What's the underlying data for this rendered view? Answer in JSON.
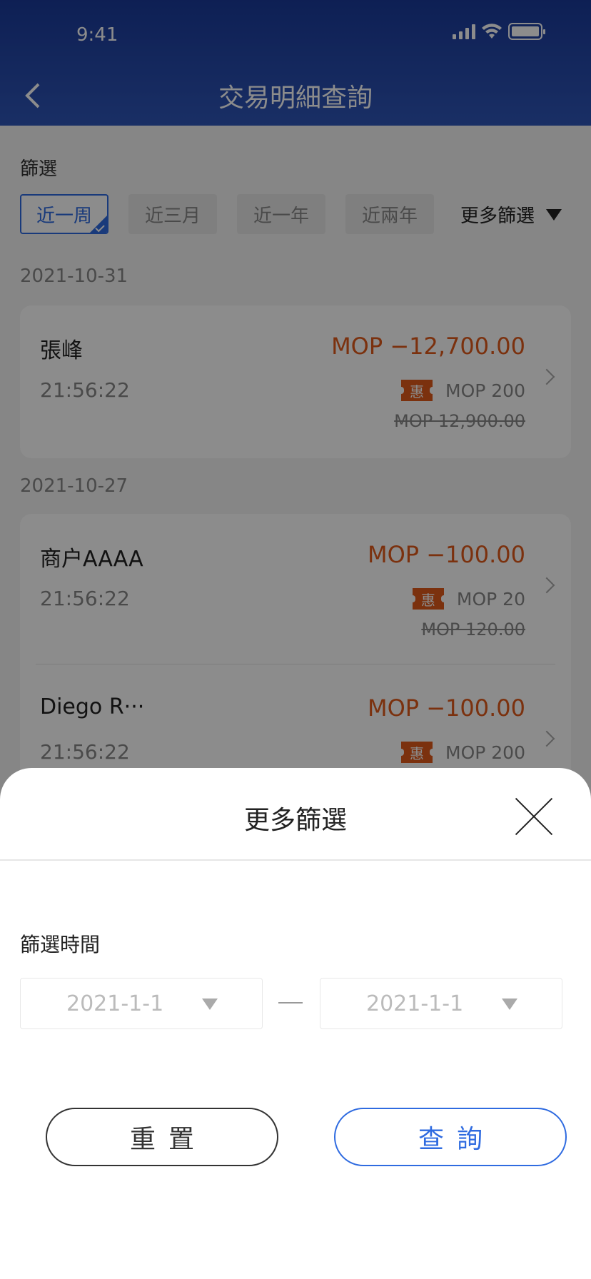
{
  "status_bar": {
    "time": "9:41"
  },
  "header": {
    "title": "交易明細查詢"
  },
  "filter": {
    "label": "篩選",
    "chips": [
      {
        "label": "近一周",
        "active": true
      },
      {
        "label": "近三月",
        "active": false
      },
      {
        "label": "近一年",
        "active": false
      },
      {
        "label": "近兩年",
        "active": false
      }
    ],
    "more_label": "更多篩選"
  },
  "groups": [
    {
      "date": "2021-10-31",
      "transactions": [
        {
          "merchant": "張峰",
          "time": "21:56:22",
          "amount": "MOP −12,700.00",
          "discount_badge": "惠",
          "discount": "MOP 200",
          "original": "MOP 12,900.00"
        }
      ]
    },
    {
      "date": "2021-10-27",
      "transactions": [
        {
          "merchant": "商户AAAA",
          "time": "21:56:22",
          "amount": "MOP −100.00",
          "discount_badge": "惠",
          "discount": "MOP 20",
          "original": "MOP 120.00"
        },
        {
          "merchant": "Diego R···",
          "time": "21:56:22",
          "amount": "MOP −100.00",
          "discount_badge": "惠",
          "discount": "MOP 200",
          "original": ""
        }
      ]
    }
  ],
  "sheet": {
    "title": "更多篩選",
    "time_label": "篩選時間",
    "start_date": "2021-1-1",
    "end_date": "2021-1-1",
    "reset_label": "重置",
    "query_label": "查詢"
  },
  "colors": {
    "header": "#1a3a9a",
    "accent": "#2f6be0",
    "amount": "#e0591a"
  }
}
